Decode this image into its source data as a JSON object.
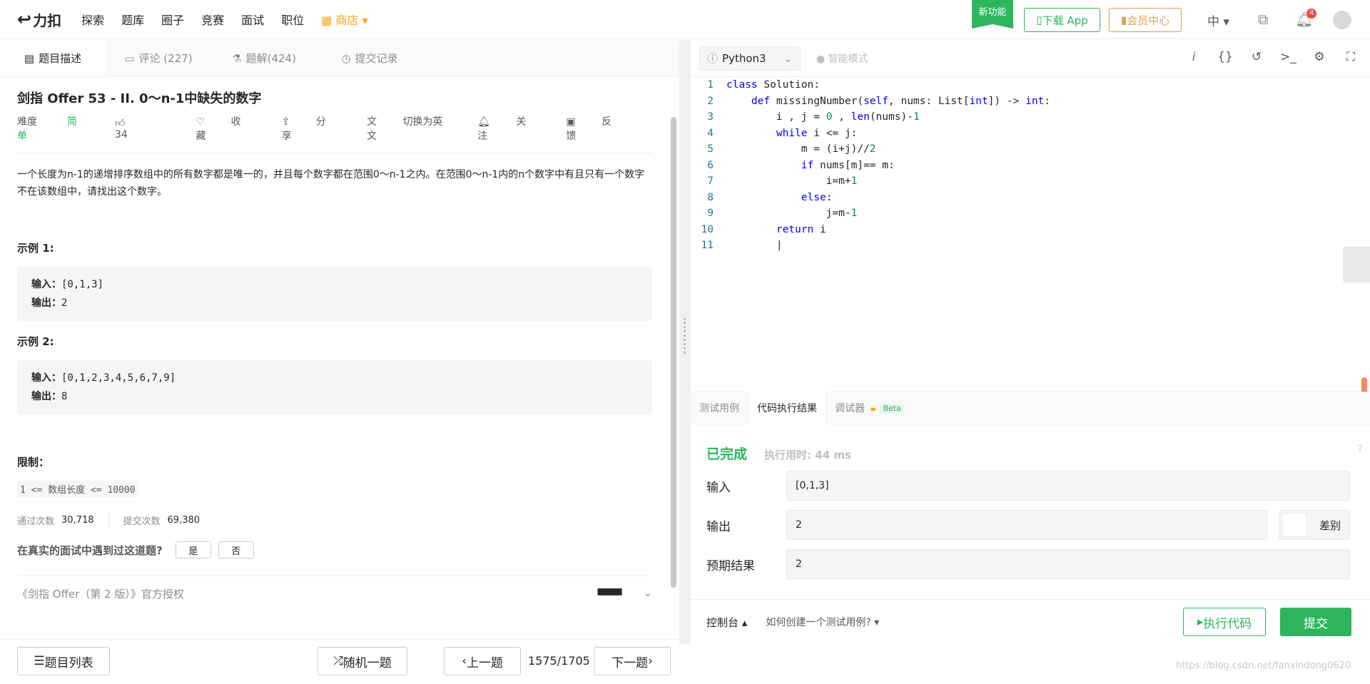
{
  "nav": {
    "logo": "力扣",
    "links": [
      "探索",
      "题库",
      "圈子",
      "竞赛",
      "面试",
      "职位"
    ],
    "store": "商店",
    "new_feature": "新功能",
    "download_app": "下载 App",
    "vip": "会员中心",
    "lang": "中",
    "notification_count": "4"
  },
  "left": {
    "tabs": [
      "题目描述",
      "评论 (227)",
      "题解(424)",
      "提交记录"
    ],
    "title": "剑指 Offer 53 - II. 0～n-1中缺失的数字",
    "difficulty_label": "难度",
    "difficulty": "简单",
    "likes": "34",
    "favorite": "收藏",
    "share": "分享",
    "switch_en": "切换为英文",
    "follow": "关注",
    "feedback": "反馈",
    "description": "一个长度为n-1的递增排序数组中的所有数字都是唯一的，并且每个数字都在范围0～n-1之内。在范围0～n-1内的n个数字中有且只有一个数字不在该数组中，请找出这个数字。",
    "example1_title": "示例 1:",
    "example1_in_label": "输入：",
    "example1_in": "[0,1,3]",
    "example1_out_label": "输出：",
    "example1_out": "2",
    "example2_title": "示例 2:",
    "example2_in_label": "输入：",
    "example2_in": "[0,1,2,3,4,5,6,7,9]",
    "example2_out_label": "输出：",
    "example2_out": "8",
    "limit_title": "限制：",
    "limit": "1 <= 数组长度 <= 10000",
    "pass_label": "通过次数",
    "pass": "30,718",
    "submit_label": "提交次数",
    "submit": "69,380",
    "question": "在真实的面试中遇到过这道题?",
    "yes": "是",
    "no": "否",
    "authorization": "《剑指 Offer（第 2 版）》官方授权"
  },
  "bottom": {
    "problem_list": "题目列表",
    "random": "随机一题",
    "prev": "上一题",
    "page": "1575/1705",
    "next": "下一题"
  },
  "editor": {
    "language": "Python3",
    "smart_mode": "智能模式",
    "lines": [
      "class Solution:",
      "    def missingNumber(self, nums: List[int]) -> int:",
      "        i , j = 0 , len(nums)-1",
      "        while i <= j:",
      "            m = (i+j)//2",
      "            if nums[m]== m:",
      "                i=m+1",
      "            else:",
      "                j=m-1",
      "        return i",
      "        "
    ]
  },
  "result": {
    "tabs": [
      "测试用例",
      "代码执行结果",
      "调试器"
    ],
    "beta": "Beta",
    "status": "已完成",
    "time_label": "执行用时: 44 ms",
    "input_label": "输入",
    "input": "[0,1,3]",
    "output_label": "输出",
    "output": "2",
    "diff_label": "差别",
    "expected_label": "预期结果",
    "expected": "2"
  },
  "rbottom": {
    "console": "控制台",
    "howto": "如何创建一个测试用例?",
    "run": "执行代码",
    "submit": "提交"
  },
  "watermark": "https://blog.csdn.net/fanxindong0620",
  "colors": {
    "accent": "#2db55d",
    "store": "#ffa116",
    "vip": "#d9a05b"
  }
}
